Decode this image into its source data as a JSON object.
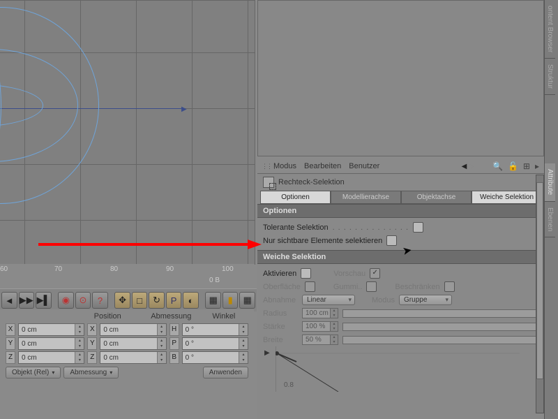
{
  "viewport": {
    "ruler_ticks": [
      "60",
      "70",
      "80",
      "90",
      "100"
    ],
    "timeline": "0 B"
  },
  "coords": {
    "headers": {
      "pos": "Position",
      "dim": "Abmessung",
      "ang": "Winkel"
    },
    "rows": [
      {
        "axis": "X",
        "pos": "0 cm",
        "dim_axis": "X",
        "dim": "0 cm",
        "rot_axis": "H",
        "ang": "0 °"
      },
      {
        "axis": "Y",
        "pos": "0 cm",
        "dim_axis": "Y",
        "dim": "0 cm",
        "rot_axis": "P",
        "ang": "0 °"
      },
      {
        "axis": "Z",
        "pos": "0 cm",
        "dim_axis": "Z",
        "dim": "0 cm",
        "rot_axis": "B",
        "ang": "0 °"
      }
    ],
    "mode": "Objekt (Rel)",
    "dim_mode": "Abmessung",
    "apply": "Anwenden"
  },
  "attr": {
    "menus": [
      "Modus",
      "Bearbeiten",
      "Benutzer"
    ],
    "tool": "Rechteck-Selektion",
    "tabs": [
      "Optionen",
      "Modellierachse",
      "Objektachse",
      "Weiche Selektion"
    ],
    "section1": "Optionen",
    "opt1": "Tolerante Selektion",
    "opt2": "Nur sichtbare Elemente selektieren",
    "section2": "Weiche Selektion",
    "activate": "Aktivieren",
    "preview": "Vorschau",
    "surface": "Oberfläche",
    "rubber": "Gummi..",
    "restrict": "Beschränken",
    "falloff_lbl": "Abnahme",
    "falloff_val": "Linear",
    "mode_lbl": "Modus",
    "mode_val": "Gruppe",
    "radius_lbl": "Radius",
    "radius_val": "100 cm",
    "strength_lbl": "Stärke",
    "strength_val": "100 %",
    "width_lbl": "Breite",
    "width_val": "50 %",
    "curve_tick": "0.8"
  },
  "sidetabs": [
    "ontent Browser",
    "Struktur",
    "Attribute",
    "Ebenen"
  ]
}
